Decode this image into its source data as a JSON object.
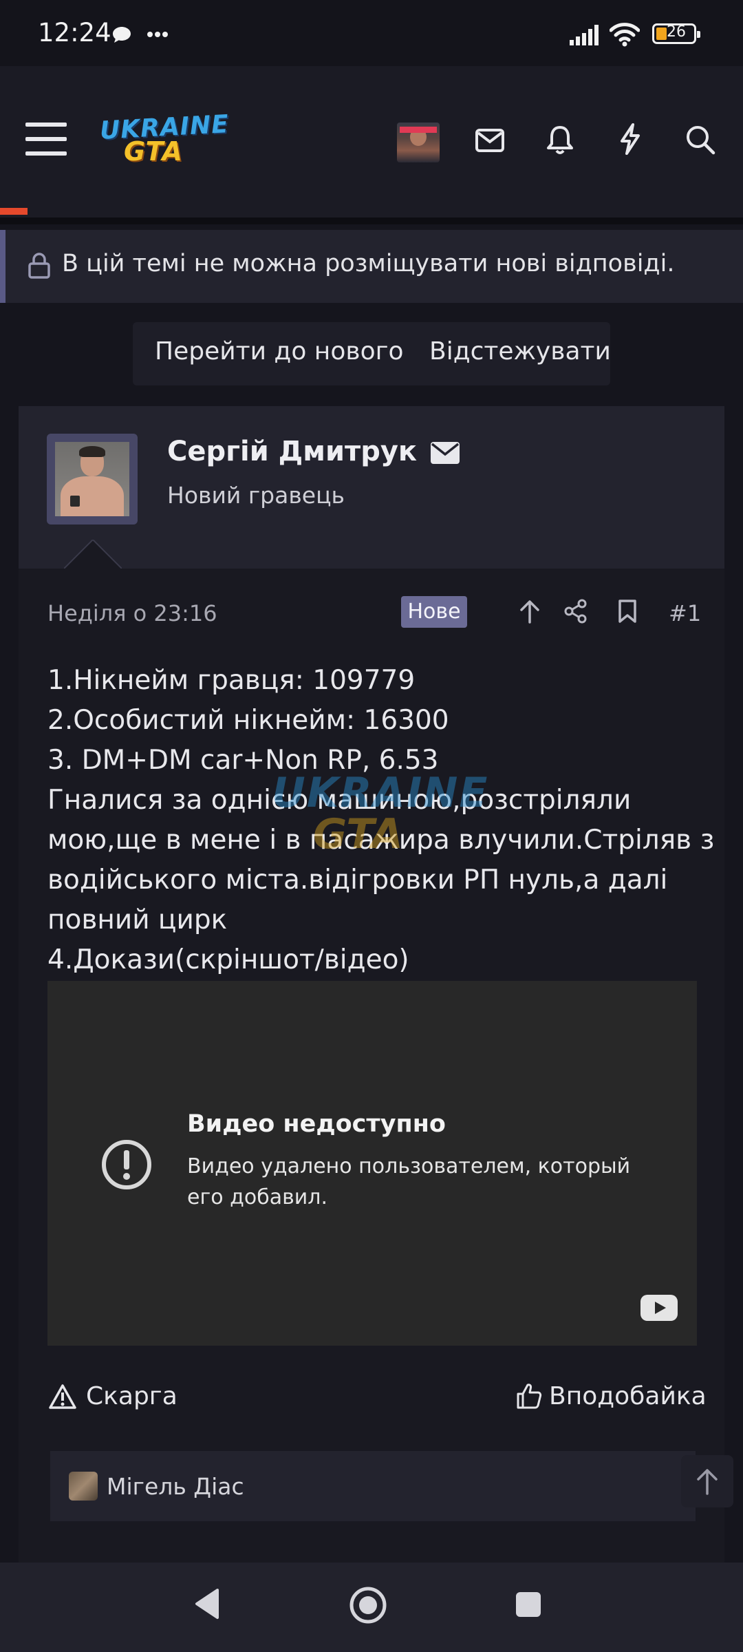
{
  "status_bar": {
    "time": "12:24",
    "battery": "26",
    "battery_color": "#f0a41d"
  },
  "header": {
    "logo_line1": "UKRAINE",
    "logo_line2": "GTA",
    "icons": [
      "menu-icon",
      "avatar",
      "mail-icon",
      "bell-icon",
      "bolt-icon",
      "search-icon"
    ],
    "accent_color": "#e5492c"
  },
  "notice": {
    "text": "В цій темі не можна розміщувати нові відповіді."
  },
  "actions": {
    "go_to_new": "Перейти до нового",
    "watch": "Відстежувати"
  },
  "post": {
    "author_name": "Сергій Дмитрук",
    "author_title": "Новий гравець",
    "date": "Неділя о 23:16",
    "badge": "Нове",
    "number": "#1",
    "lines": [
      "1.Нікнейм гравця: 109779",
      "2.Особистий нікнейм: 16300",
      "3. DM+DM car+Non RP, 6.53",
      "Гналися за однією машиною,розстріляли",
      "мою,ще в мене і в пасажира влучили.Стріляв з",
      "водійського міста.відігровки РП нуль,а далі",
      "повний цирк",
      "4.Докази(скріншот/відео)"
    ],
    "video": {
      "title": "Видео недоступно",
      "message": "Видео удалено пользователем, который его добавил."
    },
    "report_label": "Скарга",
    "like_label": "Вподобайка",
    "liked_by": "Мігель Діас"
  },
  "nav_bar": {
    "icons": [
      "back-icon",
      "home-icon",
      "recents-icon"
    ]
  }
}
